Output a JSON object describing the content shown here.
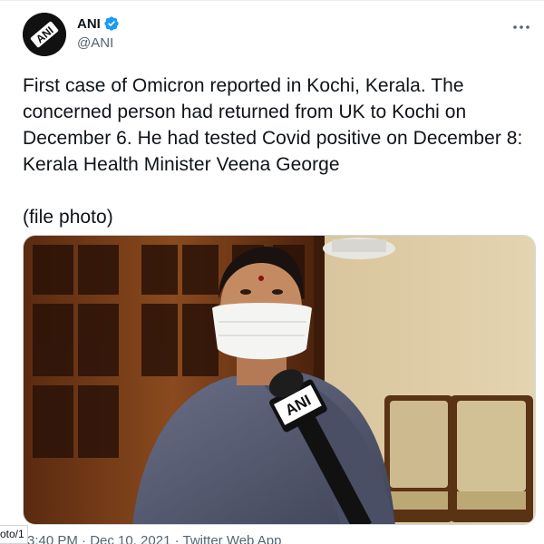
{
  "tweet": {
    "display_name": "ANI",
    "handle": "@ANI",
    "avatar_logo_text": "ANI",
    "verified": true,
    "text": "First case of Omicron reported in Kochi, Kerala. The concerned person had returned from UK to Kochi on December 6. He had tested  Covid positive on December 8: Kerala Health Minister Veena George\n\n(file photo)",
    "media_alt": "",
    "mic_logo_text": "ANI",
    "timestamp": "3:40 PM · Dec 10, 2021 · Twitter Web App"
  },
  "left_clip_text": "oto/1",
  "icons": {
    "verified": "verified-badge-icon",
    "more": "more-options-icon"
  },
  "colors": {
    "verified": "#1d9bf0",
    "text": "#0f1419",
    "muted": "#536471",
    "border": "#cfd9de"
  }
}
